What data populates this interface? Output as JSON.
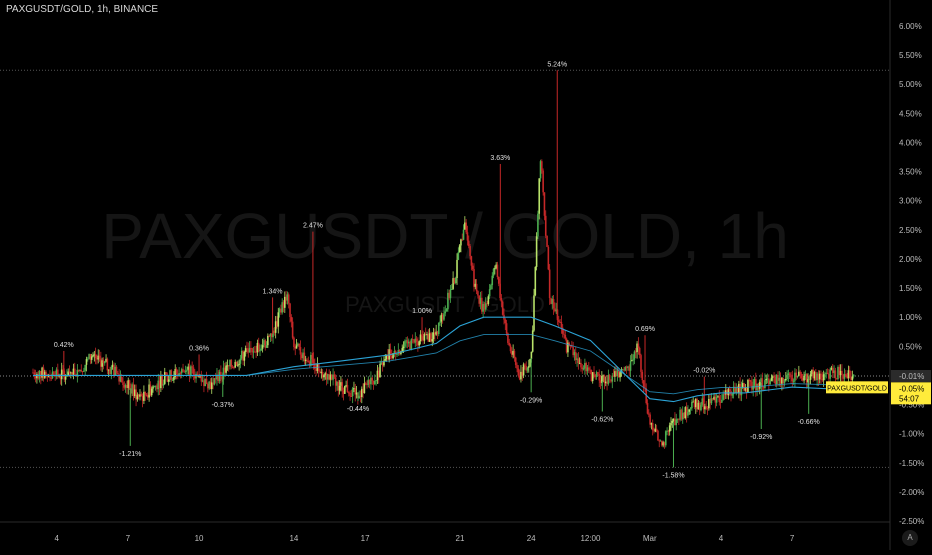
{
  "header": {
    "symbol_line": "PAXGUSDT/GOLD, 1h, BINANCE"
  },
  "watermark": {
    "big": "PAXGUSDT / GOLD, 1h",
    "small": "PAXGUSDT / GOLD"
  },
  "axis_button": {
    "label": "A"
  },
  "colors": {
    "background": "#000000",
    "candle_up": "#4caf50",
    "candle_up_light": "#b9e36a",
    "candle_down": "#c62828",
    "ma_color": "#2ba3d6",
    "price_label_bg": "#ffeb3b",
    "grid_dotted": "#555555"
  },
  "chart_data": {
    "type": "candlestick",
    "title": "PAXGUSDT/GOLD, 1h, BINANCE",
    "y_unit": "%",
    "ylim": [
      -2.5,
      6.0
    ],
    "y_ticks": [
      6.0,
      5.5,
      5.0,
      4.5,
      4.0,
      3.5,
      3.0,
      2.5,
      2.0,
      1.5,
      1.0,
      0.5,
      0.0,
      -0.5,
      -1.0,
      -1.5,
      -2.0,
      -2.5
    ],
    "y_tick_labels": [
      "6.00%",
      "5.50%",
      "5.00%",
      "4.50%",
      "4.00%",
      "3.50%",
      "3.00%",
      "2.50%",
      "2.00%",
      "1.50%",
      "1.00%",
      "0.50%",
      "0.00%",
      "-0.50%",
      "-1.00%",
      "-1.50%",
      "-2.00%",
      "-2.50%"
    ],
    "x_tick_labels": [
      "4",
      "7",
      "10",
      "14",
      "17",
      "21",
      "24",
      "12:00",
      "Mar",
      "4",
      "7"
    ],
    "x_ticks_session": [
      0,
      3,
      6,
      10,
      13,
      17,
      20,
      22.5,
      25,
      28,
      31
    ],
    "x_range_session": [
      -1,
      34.2
    ],
    "reference_lines": [
      5.24,
      -1.58
    ],
    "current": {
      "label": "PAXGUSDT/GOLD",
      "value": "-0.05%",
      "countdown": "54:07",
      "ma_value": "-0.01%"
    },
    "path_points": [
      [
        -1,
        0.05
      ],
      [
        0,
        0.0
      ],
      [
        1,
        0.1
      ],
      [
        1.5,
        0.35
      ],
      [
        2.5,
        0.05
      ],
      [
        3.5,
        -0.4
      ],
      [
        4.5,
        -0.05
      ],
      [
        5.5,
        0.1
      ],
      [
        6.5,
        -0.15
      ],
      [
        7,
        0.05
      ],
      [
        8,
        0.4
      ],
      [
        9,
        0.6
      ],
      [
        9.7,
        1.4
      ],
      [
        10,
        0.5
      ],
      [
        11,
        0.15
      ],
      [
        12,
        -0.2
      ],
      [
        12.8,
        -0.3
      ],
      [
        13.5,
        0.0
      ],
      [
        14,
        0.35
      ],
      [
        15,
        0.55
      ],
      [
        16,
        0.7
      ],
      [
        16.8,
        1.7
      ],
      [
        17.2,
        2.7
      ],
      [
        17.6,
        1.6
      ],
      [
        18,
        1.1
      ],
      [
        18.5,
        1.9
      ],
      [
        19,
        0.6
      ],
      [
        19.5,
        0.0
      ],
      [
        20,
        0.3
      ],
      [
        20.4,
        3.8
      ],
      [
        20.8,
        1.3
      ],
      [
        21,
        1.1
      ],
      [
        21.5,
        0.5
      ],
      [
        22,
        0.3
      ],
      [
        22.5,
        0.0
      ],
      [
        23,
        -0.1
      ],
      [
        24,
        0.05
      ],
      [
        24.5,
        0.5
      ],
      [
        25,
        -0.8
      ],
      [
        25.5,
        -1.2
      ],
      [
        26,
        -0.8
      ],
      [
        26.5,
        -0.6
      ],
      [
        27,
        -0.5
      ],
      [
        28,
        -0.4
      ],
      [
        29,
        -0.2
      ],
      [
        30,
        -0.1
      ],
      [
        31,
        -0.05
      ],
      [
        32,
        0.0
      ],
      [
        33,
        0.05
      ],
      [
        33.6,
        -0.05
      ]
    ],
    "ma_points": [
      [
        -1,
        0.0
      ],
      [
        8,
        0.0
      ],
      [
        10,
        0.15
      ],
      [
        12,
        0.25
      ],
      [
        14,
        0.35
      ],
      [
        16,
        0.55
      ],
      [
        17,
        0.85
      ],
      [
        18,
        1.0
      ],
      [
        19,
        1.0
      ],
      [
        20,
        1.0
      ],
      [
        21,
        0.85
      ],
      [
        22.5,
        0.6
      ],
      [
        24,
        0.0
      ],
      [
        25,
        -0.4
      ],
      [
        26,
        -0.45
      ],
      [
        27,
        -0.35
      ],
      [
        28,
        -0.3
      ],
      [
        29,
        -0.3
      ],
      [
        30,
        -0.25
      ],
      [
        31,
        -0.2
      ],
      [
        33.6,
        -0.25
      ]
    ],
    "annotations": [
      {
        "x": 0.3,
        "y": 0.42,
        "label": "0.42%"
      },
      {
        "x": 3.1,
        "y": -1.21,
        "label": "-1.21%"
      },
      {
        "x": 6.0,
        "y": 0.36,
        "label": "0.36%"
      },
      {
        "x": 7.0,
        "y": -0.37,
        "label": "-0.37%"
      },
      {
        "x": 9.1,
        "y": 1.34,
        "label": "1.34%"
      },
      {
        "x": 10.8,
        "y": 2.47,
        "label": "2.47%"
      },
      {
        "x": 12.7,
        "y": -0.44,
        "label": "-0.44%"
      },
      {
        "x": 15.4,
        "y": 1.0,
        "label": "1.00%"
      },
      {
        "x": 18.7,
        "y": 3.63,
        "label": "3.63%"
      },
      {
        "x": 20.0,
        "y": -0.29,
        "label": "-0.29%"
      },
      {
        "x": 21.1,
        "y": 5.24,
        "label": "5.24%"
      },
      {
        "x": 23.0,
        "y": -0.62,
        "label": "-0.62%"
      },
      {
        "x": 24.8,
        "y": 0.69,
        "label": "0.69%"
      },
      {
        "x": 26.0,
        "y": -1.58,
        "label": "-1.58%"
      },
      {
        "x": 27.3,
        "y": -0.02,
        "label": "-0.02%"
      },
      {
        "x": 29.7,
        "y": -0.92,
        "label": "-0.92%"
      },
      {
        "x": 31.7,
        "y": -0.66,
        "label": "-0.66%"
      }
    ]
  }
}
